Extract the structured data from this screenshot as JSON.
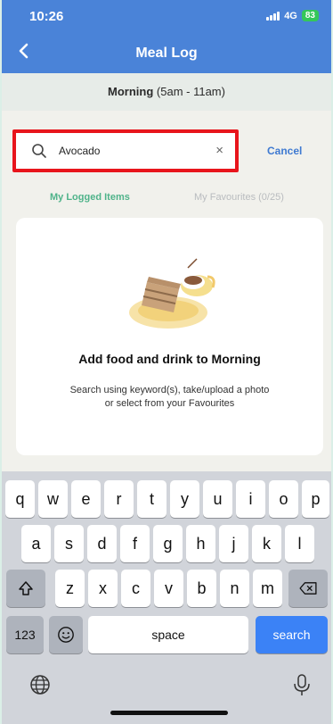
{
  "status_bar": {
    "time": "10:26",
    "network": "4G",
    "battery": "83"
  },
  "header": {
    "title": "Meal Log"
  },
  "meal_period": {
    "name": "Morning",
    "range": " (5am - 11am)"
  },
  "search": {
    "value": "Avocado",
    "placeholder": "",
    "clear_symbol": "×",
    "cancel_label": "Cancel"
  },
  "tabs": [
    {
      "label": "My Logged Items",
      "active": true
    },
    {
      "label": "My Favourites (0/25)",
      "active": false
    }
  ],
  "empty_state": {
    "title": "Add food and drink to Morning",
    "line1": "Search using keyword(s), take/upload a photo",
    "line2": "or select from your Favourites"
  },
  "keyboard": {
    "row1": [
      "q",
      "w",
      "e",
      "r",
      "t",
      "y",
      "u",
      "i",
      "o",
      "p"
    ],
    "row2": [
      "a",
      "s",
      "d",
      "f",
      "g",
      "h",
      "j",
      "k",
      "l"
    ],
    "row3": [
      "z",
      "x",
      "c",
      "v",
      "b",
      "n",
      "m"
    ],
    "numbers_label": "123",
    "space_label": "space",
    "search_label": "search"
  },
  "colors": {
    "header": "#4a83d8",
    "accent_green": "#4fb38a",
    "highlight_red": "#e8151c",
    "search_key": "#3b82f6"
  }
}
